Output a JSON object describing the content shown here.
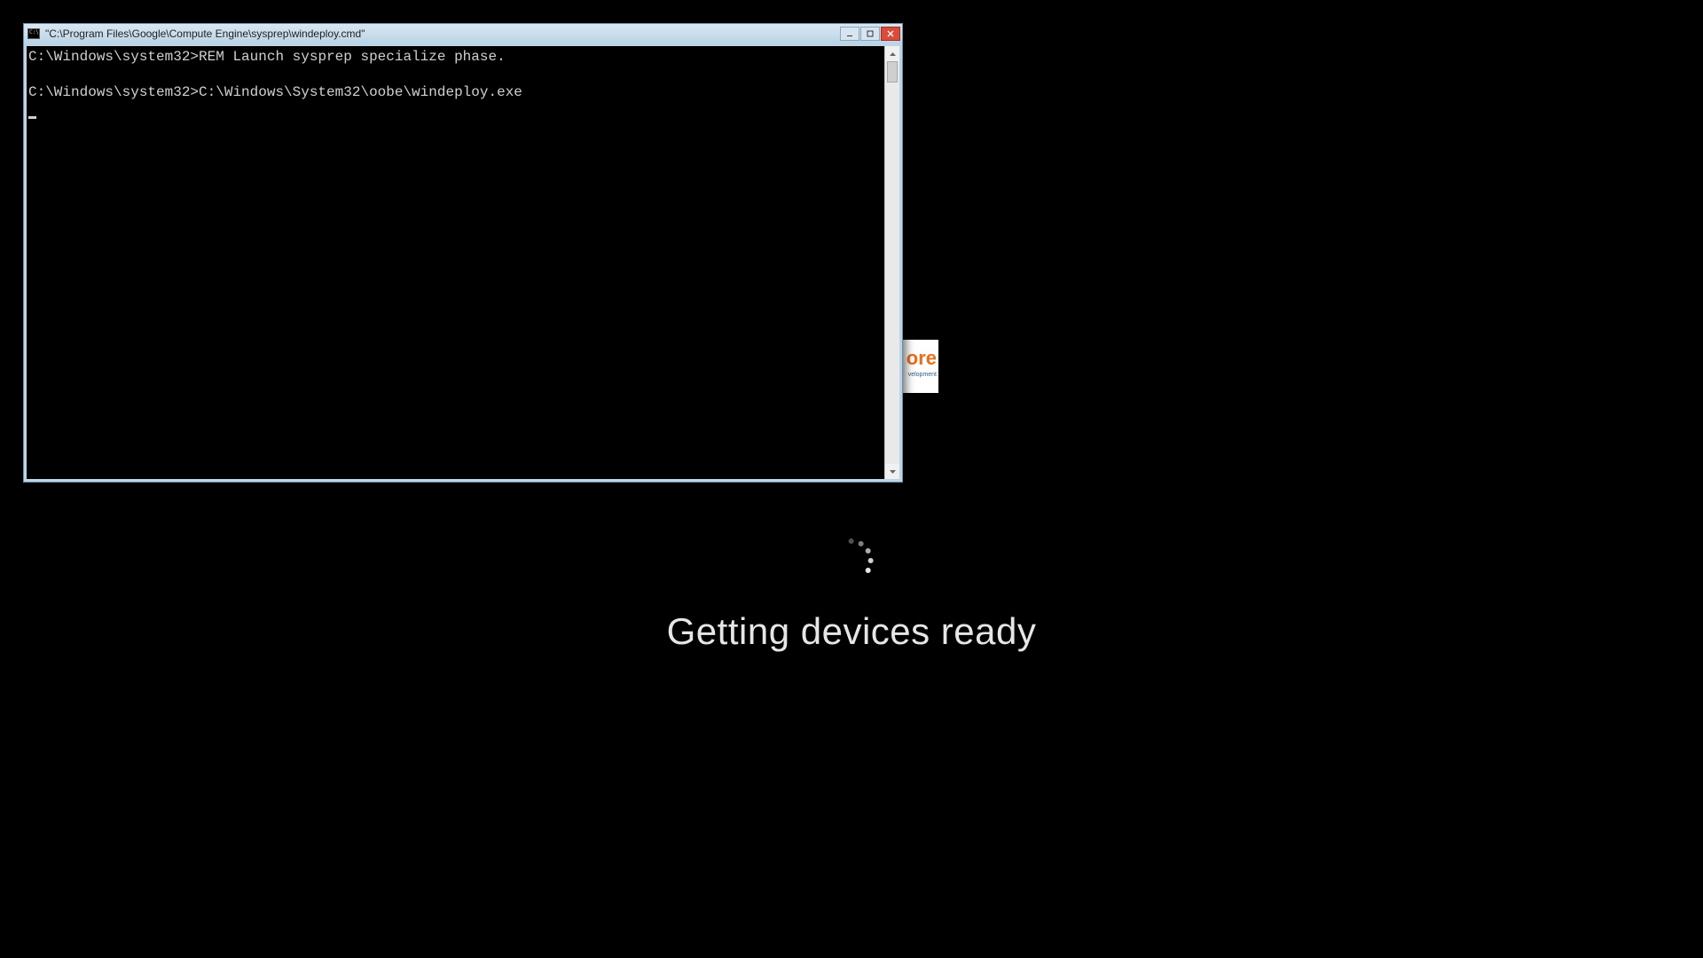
{
  "boot": {
    "status_text": "Getting devices ready"
  },
  "logo": {
    "fragment_text": "ore",
    "fragment_subtext": "velopment"
  },
  "cmd": {
    "title": "\"C:\\Program Files\\Google\\Compute Engine\\sysprep\\windeploy.cmd\"",
    "prompt": "C:\\Windows\\system32>",
    "lines": [
      "REM Launch sysprep specialize phase.",
      "",
      "C:\\Windows\\System32\\oobe\\windeploy.exe"
    ]
  }
}
